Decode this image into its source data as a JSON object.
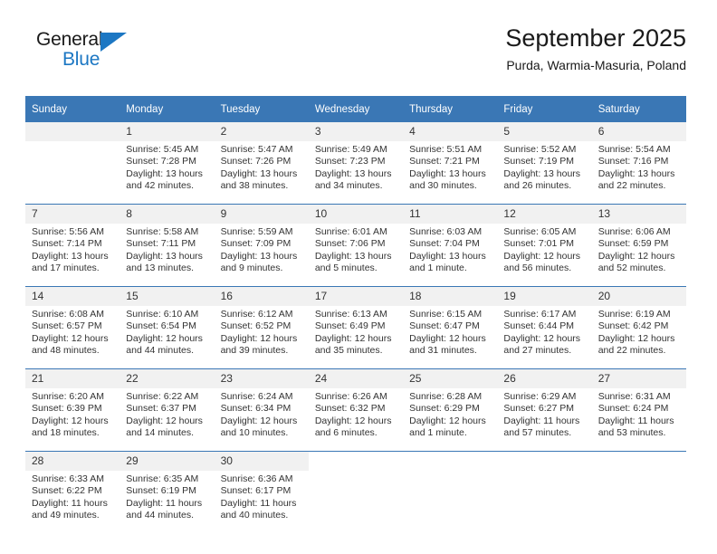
{
  "brand": {
    "word_top": "General",
    "word_bottom": "Blue",
    "accent_color": "#1c77c3",
    "triangle_icon": "brand-triangle-icon"
  },
  "header": {
    "title": "September 2025",
    "location": "Purda, Warmia-Masuria, Poland"
  },
  "calendar": {
    "header_background": "#3a77b5",
    "daynum_background": "#f1f1f1",
    "weekdays": [
      "Sunday",
      "Monday",
      "Tuesday",
      "Wednesday",
      "Thursday",
      "Friday",
      "Saturday"
    ],
    "weeks": [
      [
        {
          "day": "",
          "sunrise": "",
          "sunset": "",
          "daylight1": "",
          "daylight2": "",
          "empty": true
        },
        {
          "day": "1",
          "sunrise": "Sunrise: 5:45 AM",
          "sunset": "Sunset: 7:28 PM",
          "daylight1": "Daylight: 13 hours",
          "daylight2": "and 42 minutes."
        },
        {
          "day": "2",
          "sunrise": "Sunrise: 5:47 AM",
          "sunset": "Sunset: 7:26 PM",
          "daylight1": "Daylight: 13 hours",
          "daylight2": "and 38 minutes."
        },
        {
          "day": "3",
          "sunrise": "Sunrise: 5:49 AM",
          "sunset": "Sunset: 7:23 PM",
          "daylight1": "Daylight: 13 hours",
          "daylight2": "and 34 minutes."
        },
        {
          "day": "4",
          "sunrise": "Sunrise: 5:51 AM",
          "sunset": "Sunset: 7:21 PM",
          "daylight1": "Daylight: 13 hours",
          "daylight2": "and 30 minutes."
        },
        {
          "day": "5",
          "sunrise": "Sunrise: 5:52 AM",
          "sunset": "Sunset: 7:19 PM",
          "daylight1": "Daylight: 13 hours",
          "daylight2": "and 26 minutes."
        },
        {
          "day": "6",
          "sunrise": "Sunrise: 5:54 AM",
          "sunset": "Sunset: 7:16 PM",
          "daylight1": "Daylight: 13 hours",
          "daylight2": "and 22 minutes."
        }
      ],
      [
        {
          "day": "7",
          "sunrise": "Sunrise: 5:56 AM",
          "sunset": "Sunset: 7:14 PM",
          "daylight1": "Daylight: 13 hours",
          "daylight2": "and 17 minutes."
        },
        {
          "day": "8",
          "sunrise": "Sunrise: 5:58 AM",
          "sunset": "Sunset: 7:11 PM",
          "daylight1": "Daylight: 13 hours",
          "daylight2": "and 13 minutes."
        },
        {
          "day": "9",
          "sunrise": "Sunrise: 5:59 AM",
          "sunset": "Sunset: 7:09 PM",
          "daylight1": "Daylight: 13 hours",
          "daylight2": "and 9 minutes."
        },
        {
          "day": "10",
          "sunrise": "Sunrise: 6:01 AM",
          "sunset": "Sunset: 7:06 PM",
          "daylight1": "Daylight: 13 hours",
          "daylight2": "and 5 minutes."
        },
        {
          "day": "11",
          "sunrise": "Sunrise: 6:03 AM",
          "sunset": "Sunset: 7:04 PM",
          "daylight1": "Daylight: 13 hours",
          "daylight2": "and 1 minute."
        },
        {
          "day": "12",
          "sunrise": "Sunrise: 6:05 AM",
          "sunset": "Sunset: 7:01 PM",
          "daylight1": "Daylight: 12 hours",
          "daylight2": "and 56 minutes."
        },
        {
          "day": "13",
          "sunrise": "Sunrise: 6:06 AM",
          "sunset": "Sunset: 6:59 PM",
          "daylight1": "Daylight: 12 hours",
          "daylight2": "and 52 minutes."
        }
      ],
      [
        {
          "day": "14",
          "sunrise": "Sunrise: 6:08 AM",
          "sunset": "Sunset: 6:57 PM",
          "daylight1": "Daylight: 12 hours",
          "daylight2": "and 48 minutes."
        },
        {
          "day": "15",
          "sunrise": "Sunrise: 6:10 AM",
          "sunset": "Sunset: 6:54 PM",
          "daylight1": "Daylight: 12 hours",
          "daylight2": "and 44 minutes."
        },
        {
          "day": "16",
          "sunrise": "Sunrise: 6:12 AM",
          "sunset": "Sunset: 6:52 PM",
          "daylight1": "Daylight: 12 hours",
          "daylight2": "and 39 minutes."
        },
        {
          "day": "17",
          "sunrise": "Sunrise: 6:13 AM",
          "sunset": "Sunset: 6:49 PM",
          "daylight1": "Daylight: 12 hours",
          "daylight2": "and 35 minutes."
        },
        {
          "day": "18",
          "sunrise": "Sunrise: 6:15 AM",
          "sunset": "Sunset: 6:47 PM",
          "daylight1": "Daylight: 12 hours",
          "daylight2": "and 31 minutes."
        },
        {
          "day": "19",
          "sunrise": "Sunrise: 6:17 AM",
          "sunset": "Sunset: 6:44 PM",
          "daylight1": "Daylight: 12 hours",
          "daylight2": "and 27 minutes."
        },
        {
          "day": "20",
          "sunrise": "Sunrise: 6:19 AM",
          "sunset": "Sunset: 6:42 PM",
          "daylight1": "Daylight: 12 hours",
          "daylight2": "and 22 minutes."
        }
      ],
      [
        {
          "day": "21",
          "sunrise": "Sunrise: 6:20 AM",
          "sunset": "Sunset: 6:39 PM",
          "daylight1": "Daylight: 12 hours",
          "daylight2": "and 18 minutes."
        },
        {
          "day": "22",
          "sunrise": "Sunrise: 6:22 AM",
          "sunset": "Sunset: 6:37 PM",
          "daylight1": "Daylight: 12 hours",
          "daylight2": "and 14 minutes."
        },
        {
          "day": "23",
          "sunrise": "Sunrise: 6:24 AM",
          "sunset": "Sunset: 6:34 PM",
          "daylight1": "Daylight: 12 hours",
          "daylight2": "and 10 minutes."
        },
        {
          "day": "24",
          "sunrise": "Sunrise: 6:26 AM",
          "sunset": "Sunset: 6:32 PM",
          "daylight1": "Daylight: 12 hours",
          "daylight2": "and 6 minutes."
        },
        {
          "day": "25",
          "sunrise": "Sunrise: 6:28 AM",
          "sunset": "Sunset: 6:29 PM",
          "daylight1": "Daylight: 12 hours",
          "daylight2": "and 1 minute."
        },
        {
          "day": "26",
          "sunrise": "Sunrise: 6:29 AM",
          "sunset": "Sunset: 6:27 PM",
          "daylight1": "Daylight: 11 hours",
          "daylight2": "and 57 minutes."
        },
        {
          "day": "27",
          "sunrise": "Sunrise: 6:31 AM",
          "sunset": "Sunset: 6:24 PM",
          "daylight1": "Daylight: 11 hours",
          "daylight2": "and 53 minutes."
        }
      ],
      [
        {
          "day": "28",
          "sunrise": "Sunrise: 6:33 AM",
          "sunset": "Sunset: 6:22 PM",
          "daylight1": "Daylight: 11 hours",
          "daylight2": "and 49 minutes."
        },
        {
          "day": "29",
          "sunrise": "Sunrise: 6:35 AM",
          "sunset": "Sunset: 6:19 PM",
          "daylight1": "Daylight: 11 hours",
          "daylight2": "and 44 minutes."
        },
        {
          "day": "30",
          "sunrise": "Sunrise: 6:36 AM",
          "sunset": "Sunset: 6:17 PM",
          "daylight1": "Daylight: 11 hours",
          "daylight2": "and 40 minutes."
        },
        {
          "day": "",
          "sunrise": "",
          "sunset": "",
          "daylight1": "",
          "daylight2": "",
          "blank": true
        },
        {
          "day": "",
          "sunrise": "",
          "sunset": "",
          "daylight1": "",
          "daylight2": "",
          "blank": true
        },
        {
          "day": "",
          "sunrise": "",
          "sunset": "",
          "daylight1": "",
          "daylight2": "",
          "blank": true
        },
        {
          "day": "",
          "sunrise": "",
          "sunset": "",
          "daylight1": "",
          "daylight2": "",
          "blank": true
        }
      ]
    ]
  }
}
